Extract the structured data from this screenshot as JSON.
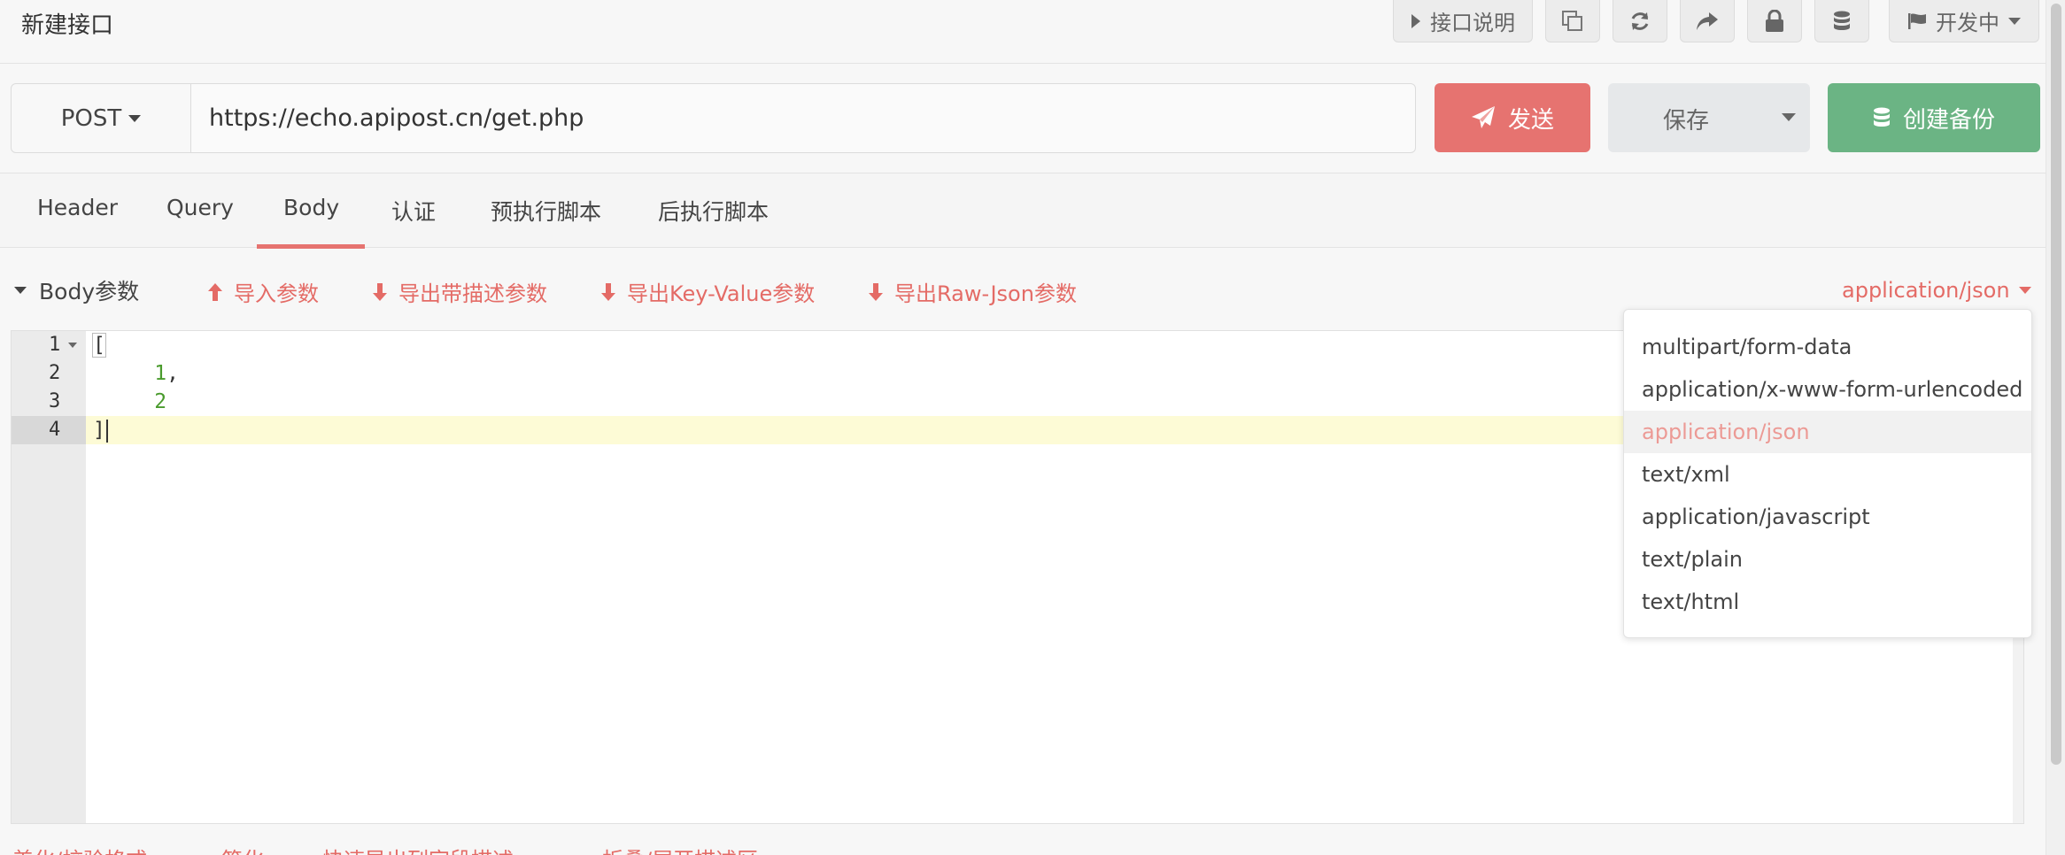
{
  "header": {
    "title": "新建接口",
    "doc_label": "接口说明",
    "env_label": "开发中",
    "icons": [
      "play-icon",
      "copy-icon",
      "refresh-icon",
      "share-icon",
      "lock-icon",
      "database-icon",
      "flag-icon"
    ]
  },
  "request": {
    "method": "POST",
    "url": "https://echo.apipost.cn/get.php",
    "send_label": "发送",
    "save_label": "保存",
    "backup_label": "创建备份"
  },
  "tabs": [
    {
      "label": "Header",
      "active": false
    },
    {
      "label": "Query",
      "active": false
    },
    {
      "label": "Body",
      "active": true
    },
    {
      "label": "认证",
      "active": false
    },
    {
      "label": "预执行脚本",
      "active": false
    },
    {
      "label": "后执行脚本",
      "active": false
    }
  ],
  "body_section": {
    "title": "Body参数",
    "actions": {
      "import": "导入参数",
      "export_desc": "导出带描述参数",
      "export_kv": "导出Key-Value参数",
      "export_raw": "导出Raw-Json参数"
    },
    "content_type": "application/json"
  },
  "editor": {
    "line_numbers": [
      "1",
      "2",
      "3",
      "4"
    ],
    "lines": {
      "l1": "[",
      "l2": "1",
      "l2_suffix": ",",
      "l3": "2",
      "l4": "]"
    },
    "active_line": 4
  },
  "content_type_options": [
    "multipart/form-data",
    "application/x-www-form-urlencoded",
    "application/json",
    "text/xml",
    "application/javascript",
    "text/plain",
    "text/html"
  ],
  "bottom_actions": {
    "beautify": "美化/校验格式",
    "simplify": "简化",
    "quick_export": "快速导出列字段描述",
    "fold": "折叠/展开描述区"
  },
  "colors": {
    "accent": "#e67370",
    "success": "#6bb484",
    "link": "#e46b66"
  }
}
